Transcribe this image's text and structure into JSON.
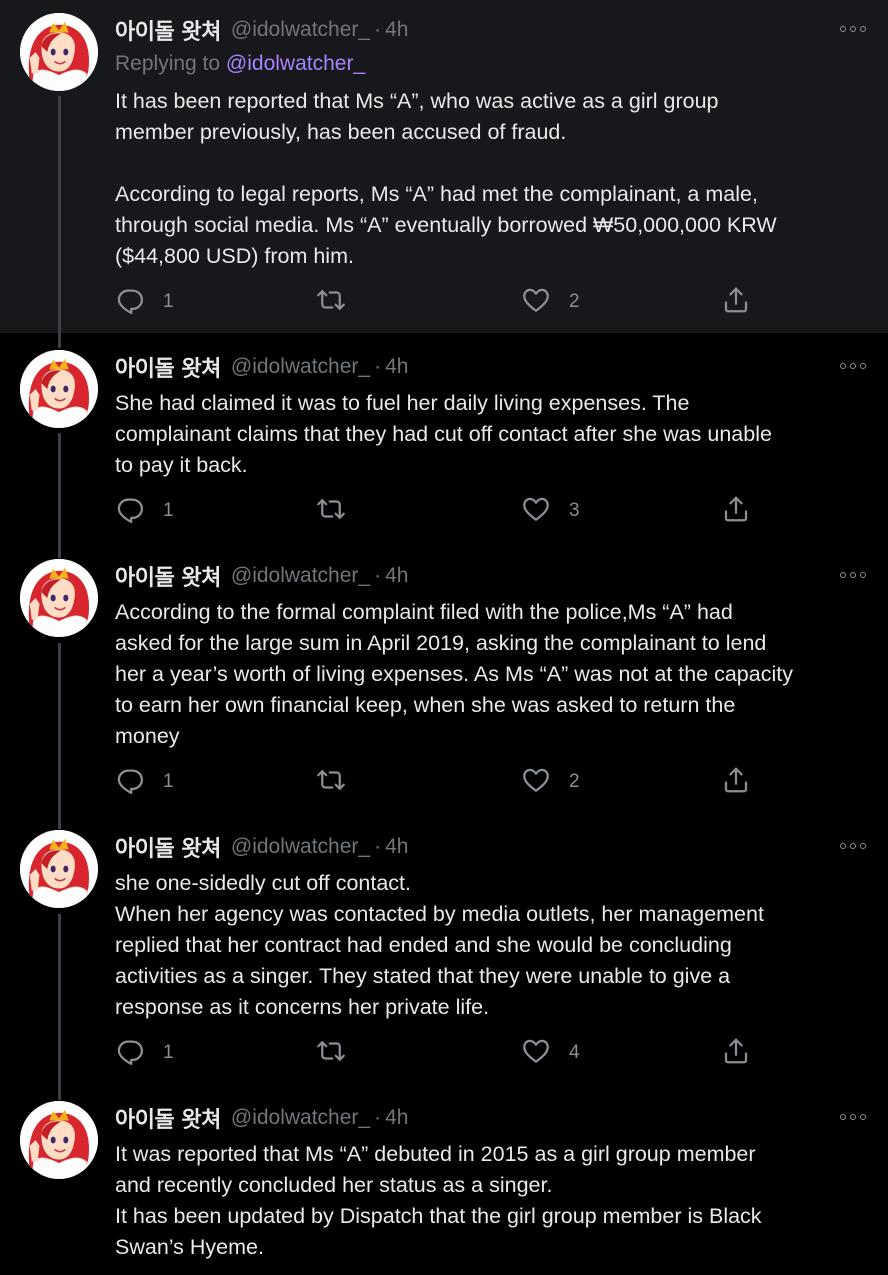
{
  "tweets": [
    {
      "name": "아이돌 왓쳐",
      "handle": "@idolwatcher_",
      "sep": "·",
      "time": "4h",
      "replying_label": "Replying to",
      "replying_mention": "@idolwatcher_",
      "lines": [
        "It has been reported that Ms “A”, who was active as a girl group",
        "member previously, has been accused of fraud.",
        "",
        "According to legal reports, Ms “A” had met the complainant, a male,",
        "through social media. Ms “A” eventually borrowed ₩50,000,000 KRW",
        "($44,800 USD) from him."
      ],
      "replies": "1",
      "retweets": "",
      "likes": "2"
    },
    {
      "name": "아이돌 왓쳐",
      "handle": "@idolwatcher_",
      "sep": "·",
      "time": "4h",
      "lines": [
        "She had claimed it was to fuel her daily living expenses. The",
        "complainant claims that they had cut off contact after she was unable",
        "to pay it back."
      ],
      "replies": "1",
      "retweets": "",
      "likes": "3"
    },
    {
      "name": "아이돌 왓쳐",
      "handle": "@idolwatcher_",
      "sep": "·",
      "time": "4h",
      "lines": [
        "According to the formal complaint filed with the police,Ms “A” had",
        "asked for the large sum in April 2019, asking the complainant to lend",
        "her a year’s worth of living expenses. As Ms “A” was not at the capacity",
        "to earn her own financial keep, when she was asked to return the",
        "money"
      ],
      "replies": "1",
      "retweets": "",
      "likes": "2"
    },
    {
      "name": "아이돌 왓쳐",
      "handle": "@idolwatcher_",
      "sep": "·",
      "time": "4h",
      "lines": [
        "she one-sidedly cut off contact.",
        "When her agency was contacted by media outlets, her management",
        "replied that her contract had ended and she would be concluding",
        "activities as a singer. They stated that they were unable to give a",
        "response as it concerns her private life."
      ],
      "replies": "1",
      "retweets": "",
      "likes": "4"
    },
    {
      "name": "아이돌 왓쳐",
      "handle": "@idolwatcher_",
      "sep": "·",
      "time": "4h",
      "lines": [
        "It was reported that Ms “A” debuted in 2015 as a girl group member",
        "and recently concluded her status as a singer.",
        "It has been updated by Dispatch that the girl group member is Black",
        "Swan’s Hyeme."
      ]
    }
  ],
  "icons": {
    "reply": "reply-icon",
    "retweet": "retweet-icon",
    "like": "heart-icon",
    "share": "share-icon",
    "more": "more-icon"
  },
  "colors": {
    "background": "#000000",
    "highlight_background": "#16181c",
    "text": "#e7e9ea",
    "muted": "#71767b",
    "mention": "#a983ff",
    "thread_line": "#3d4147"
  }
}
